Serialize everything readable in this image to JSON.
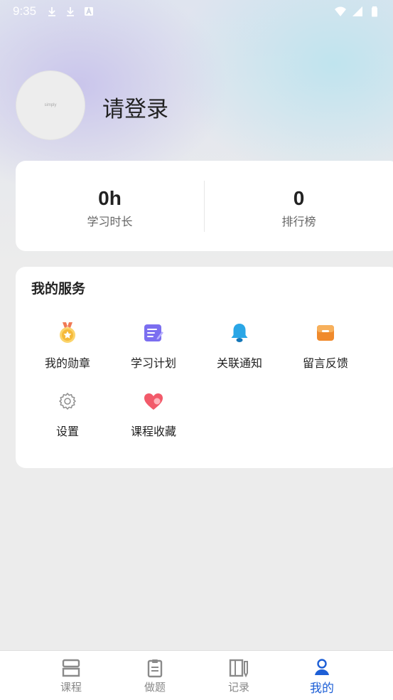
{
  "status_bar": {
    "time": "9:35",
    "left_icons": [
      "download-icon",
      "download-icon",
      "a-icon"
    ],
    "right_icons": [
      "wifi-icon",
      "signal-icon",
      "battery-icon"
    ]
  },
  "profile": {
    "avatar_text": "simply",
    "login_label": "请登录"
  },
  "stats": [
    {
      "value": "0h",
      "label": "学习时长"
    },
    {
      "value": "0",
      "label": "排行榜"
    }
  ],
  "services": {
    "title": "我的服务",
    "items": [
      {
        "label": "我的勋章",
        "icon": "medal-icon",
        "color": "#f5b93a"
      },
      {
        "label": "学习计划",
        "icon": "plan-icon",
        "color": "#7b6ef0"
      },
      {
        "label": "关联通知",
        "icon": "bell-icon",
        "color": "#2aa6e6"
      },
      {
        "label": "留言反馈",
        "icon": "mailbox-icon",
        "color": "#f08a2c"
      },
      {
        "label": "设置",
        "icon": "gear-icon",
        "color": "#9a9a9a"
      },
      {
        "label": "课程收藏",
        "icon": "heart-icon",
        "color": "#f25a6a"
      }
    ]
  },
  "tabbar": {
    "tabs": [
      {
        "label": "课程",
        "icon": "course-icon",
        "active": false
      },
      {
        "label": "做题",
        "icon": "clipboard-icon",
        "active": false
      },
      {
        "label": "记录",
        "icon": "notebook-icon",
        "active": false
      },
      {
        "label": "我的",
        "icon": "person-icon",
        "active": true
      }
    ],
    "active_color": "#1d5fd6",
    "inactive_color": "#888888"
  }
}
